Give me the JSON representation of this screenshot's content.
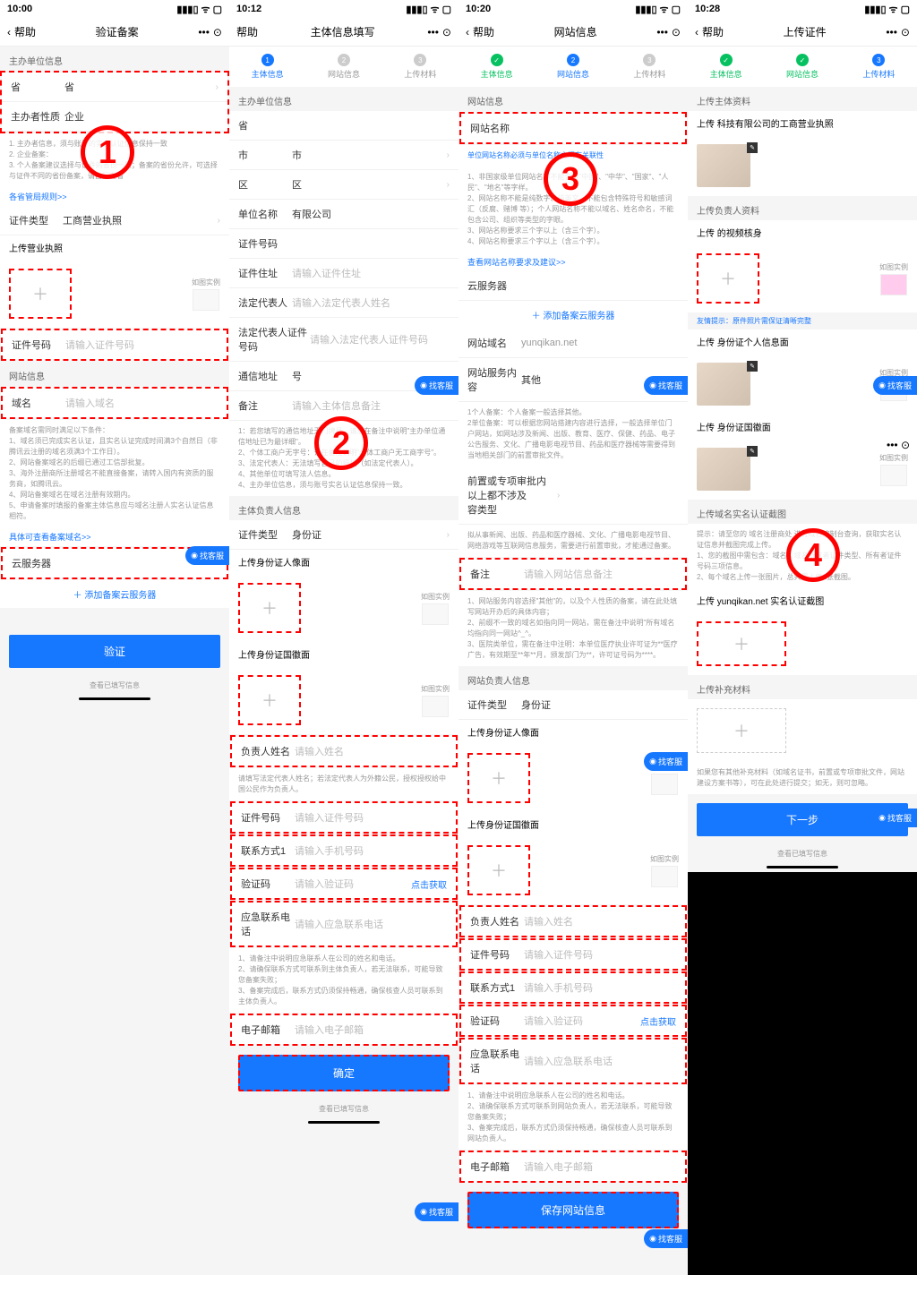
{
  "status": {
    "wifi": "ᯤ",
    "sig": "▮▮▮▯",
    "bat": "▢"
  },
  "s1": {
    "time": "10:00",
    "help": "帮助",
    "title": "验证备案",
    "more": "•••",
    "target": "⊙",
    "sec_org": "主办单位信息",
    "prov_l": "省",
    "prov_v": "省",
    "nature_l": "主办者性质",
    "nature_v": "企业",
    "tips1": "1. 主办者信息，须与账号的实名认证信息保持一致\n2. 企业备案：\n3. 个人备案建议选择与证件的省份一致；备案的省份允许，可选择与证件不同的省份备案，请自行查看",
    "linkrules": "各省管局规则>>",
    "cert_l": "证件类型",
    "cert_v": "工商营业执照",
    "up_lic": "上传营业执照",
    "ex": "如图实例",
    "certno_l": "证件号码",
    "certno_ph": "请输入证件号码",
    "sec_site": "网站信息",
    "domain_l": "域名",
    "domain_ph": "请输入域名",
    "tips2": "备案域名需同时满足以下条件：\n1、域名须已完成实名认证，且实名认证完成时间满3个自然日（非腾讯云注册的域名须满3个工作日）。\n2、网站备案域名的后缀已通过工信部批复。\n3、海外注册商所注册域名不能直接备案，请转入国内有资质的服务商，如腾讯云。\n4、网站备案域名在域名注册有效期内。\n5、申请备案时填报的备案主体信息应与域名注册人实名认证信息相符。",
    "linkcheck": "具体可查看备案域名>>",
    "cloud_l": "云服务器",
    "addcloud": "＋ 添加备案云服务器",
    "verify": "验证",
    "cs": "找客服",
    "viewfill": "查看已填写信息"
  },
  "s2": {
    "time": "10:12",
    "help": "帮助",
    "title": "主体信息填写",
    "more": "•••",
    "target": "⊙",
    "step1": "主体信息",
    "step2": "网站信息",
    "step3": "上传材料",
    "sec_org": "主办单位信息",
    "prov_l": "省",
    "city_l": "市",
    "city_v": "市",
    "dist_l": "区",
    "dist_v": "区",
    "unit_l": "单位名称",
    "unit_v": "有限公司",
    "certno_l": "证件号码",
    "addr_l": "证件住址",
    "addr_ph": "请输入证件住址",
    "legal_l": "法定代表人",
    "legal_ph": "请输入法定代表人姓名",
    "legalid_l": "法定代表人证件号码",
    "legalid_ph": "请输入法定代表人证件号码",
    "mail_l": "通信地址",
    "mail_v": "号",
    "remark_l": "备注",
    "remark_ph": "请输入主体信息备注",
    "tips1": "1：若您填写的通信地址无门牌号，请您在备注中说明\"主办单位通信地址已为最详细\"。\n2、个体工商户无字号：请在备注说明\"个体工商户无工商字号\"。\n3、法定代表人：无法填写自己的授权（如法定代表人）。\n4、其他单位可填写法人信息。\n4、主办单位信息，须与账号实名认证信息保持一致。",
    "sec_mgr": "主体负责人信息",
    "mgrcert_l": "证件类型",
    "mgrcert_v": "身份证",
    "up_face": "上传身份证人像面",
    "up_back": "上传身份证国徽面",
    "ex": "如图实例",
    "mgrname_l": "负责人姓名",
    "mgrname_ph": "请输入姓名",
    "tips2": "请填写法定代表人姓名；若法定代表人为外籍公民，授权授权给中国公民作为负责人。",
    "mgrid_l": "证件号码",
    "mgrid_ph": "请输入证件号码",
    "phone_l": "联系方式1",
    "phone_ph": "请输入手机号码",
    "vcode_l": "验证码",
    "vcode_ph": "请输入验证码",
    "getcode": "点击获取",
    "emerg_l": "应急联系电话",
    "emerg_ph": "请输入应急联系电话",
    "tips3": "1、请备注中说明应急联系人在公司的姓名和电话。\n2、请确保联系方式可联系到主体负责人，若无法联系，可能导致您备案失败；\n3、备案完成后，联系方式仍须保持畅通，确保核查人员可联系到主体负责人。",
    "email_l": "电子邮箱",
    "email_ph": "请输入电子邮箱",
    "confirm": "确定",
    "cs": "找客服",
    "viewfill": "查看已填写信息"
  },
  "s3": {
    "time": "10:20",
    "help": "帮助",
    "title": "网站信息",
    "more": "•••",
    "target": "⊙",
    "step1": "主体信息",
    "step2": "网站信息",
    "step3": "上传材料",
    "sec_site": "网站信息",
    "sitename_l": "网站名称",
    "tip_name": "单位网站名称必须与单位名称之间有关联性",
    "tips1": "1、非国家级单位网站名称不能含有\"中国\"、\"中华\"、\"国家\"、\"人民\"、\"地名\"等字样。\n2、网站名称不能是纯数字、纯英文、不能包含特殊符号和敏感词汇（反腐、赌博 等）；个人网站名称不能以域名、姓名命名，不能包含公司、组织等类型的字眼。\n3、网站名称要求三个字以上（含三个字）。\n4、网站名称要求三个字以上（含三个字）。",
    "linkreq": "查看网站名称要求及建议>>",
    "cloud_l": "云服务器",
    "addcloud": "＋ 添加备案云服务器",
    "domain_l": "网站域名",
    "domain_v": "yunqikan.net",
    "svc_l": "网站服务内容",
    "svc_v": "其他",
    "tips2": "1个人备案：个人备案一般选择其他。\n2单位备案：可以根据您网站搭建内容进行选择，一般选择单位门户网站，如网站涉及新闻、出版、教育、医疗、保健、药品、电子公告服务、文化、广播电影电视节目、药品和医疗器械等需要得到当地相关部门的前置审批文件。",
    "pre_l": "前置或专项审批内 以上都不涉及\n容类型",
    "tips3": "拟从事新闻、出版、药品和医疗器械、文化、广播电影电视节目、网络游戏等互联网信息服务，需要进行前置审批，才能通过备案。",
    "remark_l": "备注",
    "remark_ph": "请输入网站信息备注",
    "tips4": "1、网站服务内容选择\"其他\"的，以及个人性质的备案，请在此处填写网站开办后的具体内容；\n2、前缀不一致的域名如指向同一网站，需在备注中说明\"所有域名均指向同一网站^_^。\n3、医院类单位，需在备注中注明：本单位医疗执业许可证为**医疗广告，有效期至**年**月，颁发部门为**，许可证号码为****。",
    "sec_mgr": "网站负责人信息",
    "mgrcert_l": "证件类型",
    "mgrcert_v": "身份证",
    "up_face": "上传身份证人像面",
    "up_back": "上传身份证国徽面",
    "ex": "如图实例",
    "mgrname_l": "负责人姓名",
    "mgrname_ph": "请输入姓名",
    "mgrid_l": "证件号码",
    "mgrid_ph": "请输入证件号码",
    "phone_l": "联系方式1",
    "phone_ph": "请输入手机号码",
    "vcode_l": "验证码",
    "vcode_ph": "请输入验证码",
    "getcode": "点击获取",
    "emerg_l": "应急联系电话",
    "emerg_ph": "请输入应急联系电话",
    "tips5": "1、请备注中说明应急联系人在公司的姓名和电话。\n2、请确保联系方式可联系到网站负责人，若无法联系，可能导致您备案失败；\n3、备案完成后，联系方式仍须保持畅通，确保核查人员可联系到网站负责人。",
    "email_l": "电子邮箱",
    "email_ph": "请输入电子邮箱",
    "save": "保存网站信息",
    "cs": "找客服"
  },
  "s4": {
    "time": "10:28",
    "help": "帮助",
    "title": "上传证件",
    "more": "•••",
    "target": "⊙",
    "step1": "主体信息",
    "step2": "网站信息",
    "step3": "上传材料",
    "sec_org": "上传主体资料",
    "up_lic": "上传 科技有限公司的工商营业执照",
    "sec_mgr": "上传负责人资料",
    "up_video": "上传 的视频核身",
    "ex": "如图实例",
    "tip_clear": "友情提示：原件照片需保证清晰完整",
    "up_face": "上传 身份证个人信息面",
    "up_back": "上传 身份证国徽面",
    "sec_real": "上传域名实名认证截图",
    "tips1": "提示：请至您的 域名注册商处 进行域名控制台查询，获取实名认证信息并截图完成上传。\n1、您的截图中需包含：域名、域名所有者证件类型、所有者证件号码三项信息。\n2、每个域名上传一张图片，总共需上传1张截图。",
    "up_real": "上传 yunqikan.net 实名认证截图",
    "sec_extra": "上传补充材料",
    "tips2": "如果您有其他补充材料（如域名证书，前置或专项审批文件，网站建设方案书等），可在此处进行提交；如无，则可忽略。",
    "next": "下一步",
    "cs": "找客服",
    "viewfill": "查看已填写信息"
  }
}
